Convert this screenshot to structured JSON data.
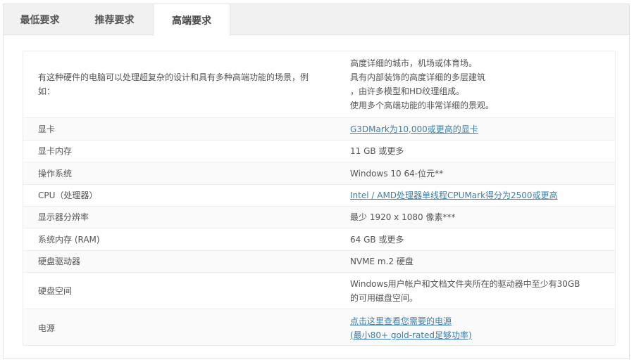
{
  "tabs": [
    {
      "label": "最低要求"
    },
    {
      "label": "推荐要求"
    },
    {
      "label": "高端要求"
    }
  ],
  "active_tab": "高端要求",
  "colors": {
    "link": "#3d7ea6",
    "text": "#555555",
    "tab_bg": "#f1f1f1",
    "border": "#e2e2e2"
  },
  "intro": {
    "label": "有这种硬件的电脑可以处理超复杂的设计和具有多种高端功能的场景，例如：",
    "lines": [
      "高度详细的城市，机场或体育场。",
      "具有内部装饰的高度详细的多层建筑",
      "，由许多模型和HD纹理组成。",
      "使用多个高端功能的非常详细的景观。"
    ]
  },
  "rows": [
    {
      "label": "显卡",
      "value": "G3DMark为10,000或更高的显卡",
      "link": true
    },
    {
      "label": "显卡内存",
      "value": "11 GB 或更多",
      "link": false
    },
    {
      "label": "操作系统",
      "value": "Windows 10 64-位元**",
      "link": false
    },
    {
      "label": "CPU（处理器）",
      "value": "Intel / AMD处理器单线程CPUMark得分为2500或更高",
      "link": true
    },
    {
      "label": "显示器分辨率",
      "value": "最少 1920 x 1080 像素***",
      "link": false
    },
    {
      "label": "系统内存 (RAM)",
      "value": "64 GB 或更多",
      "link": false
    },
    {
      "label": "硬盘驱动器",
      "value": "NVME m.2 硬盘",
      "link": false
    }
  ],
  "disk_space": {
    "label": "硬盘空间",
    "line1": "Windows用户帐户和文档文件夹所在的驱动器中至少有30GB",
    "line2": "的可用磁盘空间。"
  },
  "power": {
    "label": "电源",
    "line1": "点击这里查看您需要的电源",
    "line2": "(最小80+ gold-rated足够功率)"
  }
}
